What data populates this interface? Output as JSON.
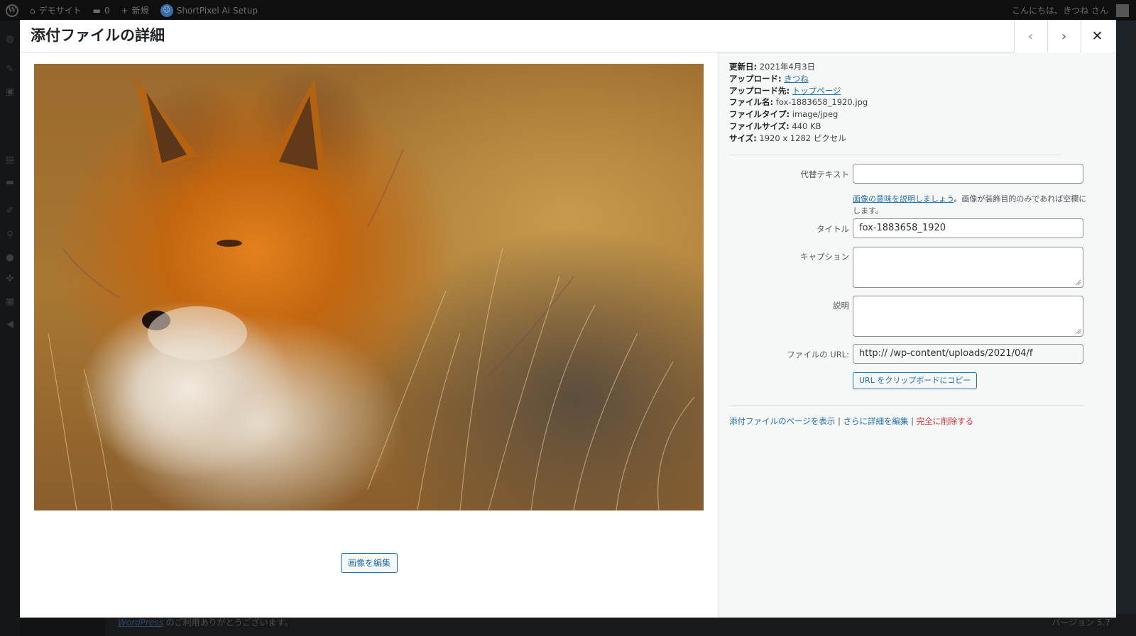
{
  "admin_bar": {
    "site_name": "デモサイト",
    "comments_count": "0",
    "new_label": "新規",
    "shortpixel_label": "ShortPixel AI Setup",
    "greeting": "こんにちは、きつね さん"
  },
  "footer": {
    "wordpress_link": "WordPress",
    "thanks_suffix": " のご利用ありがとうございます。",
    "version": "バージョン 5.7"
  },
  "modal": {
    "title": "添付ファイルの詳細",
    "prev_icon": "‹",
    "next_icon": "›",
    "close_icon": "✕"
  },
  "image": {
    "edit_button": "画像を編集"
  },
  "details": {
    "updated_label": "更新日:",
    "updated_value": "2021年4月3日",
    "uploaded_by_label": "アップロード:",
    "uploaded_by_value": "きつね",
    "uploaded_to_label": "アップロード先:",
    "uploaded_to_value": "トップページ",
    "filename_label": "ファイル名:",
    "filename_value": "fox-1883658_1920.jpg",
    "filetype_label": "ファイルタイプ:",
    "filetype_value": "image/jpeg",
    "filesize_label": "ファイルサイズ:",
    "filesize_value": "440 KB",
    "dimensions_label": "サイズ:",
    "dimensions_value": "1920 x 1282 ピクセル"
  },
  "form": {
    "alt_label": "代替テキスト",
    "alt_value": "",
    "alt_help_link": "画像の意味を説明しましょう",
    "alt_help_text": "。画像が装飾目的のみであれば空欄にします。",
    "title_label": "タイトル",
    "title_value": "fox-1883658_1920",
    "caption_label": "キャプション",
    "caption_value": "",
    "description_label": "説明",
    "description_value": "",
    "url_label": "ファイルの URL:",
    "url_value": "http://                  /wp-content/uploads/2021/04/f",
    "copy_button": "URL をクリップボードにコピー"
  },
  "actions": {
    "view_page": "添付ファイルのページを表示",
    "separator": "|",
    "edit_more": "さらに詳細を編集",
    "delete": "完全に削除する"
  },
  "colors": {
    "link": "#2271b1",
    "delete": "#d63638",
    "overlay": "#1d2327"
  }
}
